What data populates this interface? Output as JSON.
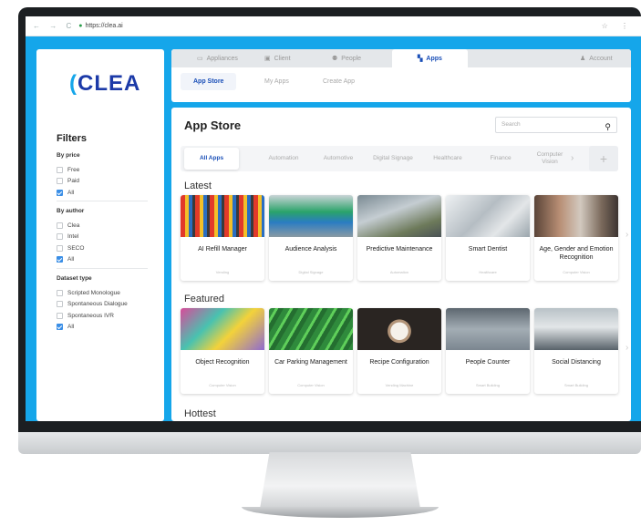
{
  "browser": {
    "url": "https://clea.ai"
  },
  "logo": {
    "paren": "(",
    "text": "CLEA"
  },
  "filters": {
    "title": "Filters",
    "groups": [
      {
        "title": "By price",
        "items": [
          {
            "label": "Free",
            "checked": false
          },
          {
            "label": "Paid",
            "checked": false
          },
          {
            "label": "All",
            "checked": true
          }
        ]
      },
      {
        "title": "By author",
        "items": [
          {
            "label": "Clea",
            "checked": false
          },
          {
            "label": "Intel",
            "checked": false
          },
          {
            "label": "SECO",
            "checked": false
          },
          {
            "label": "All",
            "checked": true
          }
        ]
      },
      {
        "title": "Dataset type",
        "items": [
          {
            "label": "Scripted Monologue",
            "checked": false
          },
          {
            "label": "Spontaneous Dialogue",
            "checked": false
          },
          {
            "label": "Spontaneous IVR",
            "checked": false
          },
          {
            "label": "All",
            "checked": true
          }
        ]
      }
    ]
  },
  "topnav": {
    "tabs": [
      "Appliances",
      "Client",
      "People",
      "Apps",
      "Account"
    ],
    "active": "Apps",
    "subtabs": [
      "App Store",
      "My Apps",
      "Create App"
    ]
  },
  "main": {
    "title": "App Store",
    "search_placeholder": "Search",
    "categories": [
      "All Apps",
      "Automation",
      "Automotive",
      "Digital Signage",
      "Healthcare",
      "Finance",
      "Computer Vision"
    ],
    "add_label": "+",
    "sections": [
      {
        "title": "Latest",
        "cards": [
          {
            "name": "AI Refill Manager",
            "category": "Vending"
          },
          {
            "name": "Audience Analysis",
            "category": "Digital Signage"
          },
          {
            "name": "Predictive Maintenance",
            "category": "Automation"
          },
          {
            "name": "Smart Dentist",
            "category": "Healthcare"
          },
          {
            "name": "Age, Gender and Emotion Recognition",
            "category": "Computer Vision"
          }
        ]
      },
      {
        "title": "Featured",
        "cards": [
          {
            "name": "Object Recognition",
            "category": "Computer Vision"
          },
          {
            "name": "Car Parking Management",
            "category": "Computer Vision"
          },
          {
            "name": "Recipe Configuration",
            "category": "Vending Machine"
          },
          {
            "name": "People Counter",
            "category": "Smart Building"
          },
          {
            "name": "Social Distancing",
            "category": "Smart Building"
          }
        ]
      },
      {
        "title": "Hottest",
        "cards": []
      }
    ]
  },
  "colors": {
    "accent": "#15a6ea",
    "brand": "#1c3aa8",
    "active_link": "#1a4fb8"
  }
}
